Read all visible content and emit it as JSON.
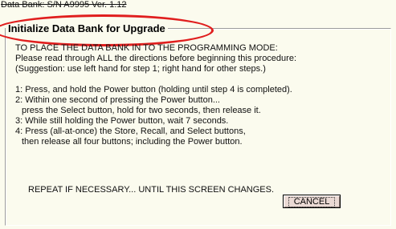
{
  "window": {
    "title": "Data Bank:  S/N A9995  Ver. 1.12"
  },
  "panel": {
    "legend": "Initialize Data Bank for Upgrade"
  },
  "instructions": {
    "intro": [
      "TO PLACE THE DATA BANK IN TO THE PROGRAMMING MODE:",
      "Please read through ALL the directions before beginning this procedure:",
      "(Suggestion: use left hand for step 1; right hand for other steps.)"
    ],
    "steps": [
      "1: Press, and hold the Power button (holding until step 4 is completed).",
      "2: Within one second of pressing the Power button...",
      "press the Select button, hold for two seconds, then release it.",
      "3: While still holding the Power button, wait 7 seconds.",
      "4: Press (all-at-once) the Store, Recall, and Select buttons,",
      "then release all four buttons; including the Power button."
    ],
    "repeat": "REPEAT IF NECESSARY... UNTIL THIS SCREEN CHANGES."
  },
  "buttons": {
    "cancel_label": "CANCEL"
  },
  "colors": {
    "background": "#fbfbee",
    "highlight_ellipse": "#e01e1e",
    "cancel_button_bg": "#ead9d4"
  }
}
